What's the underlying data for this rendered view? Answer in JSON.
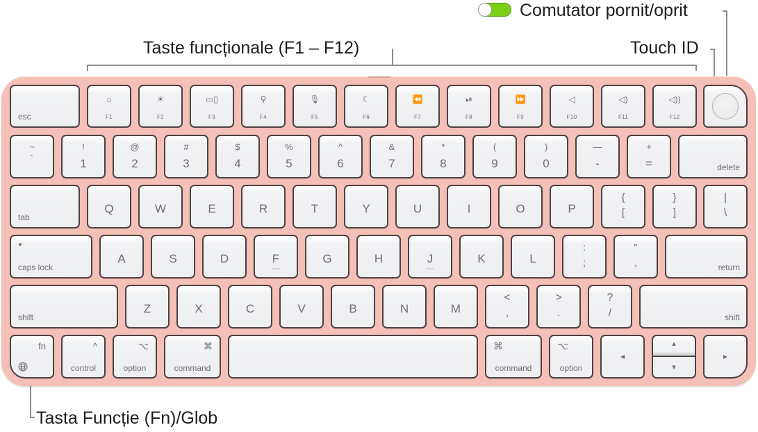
{
  "callouts": {
    "power_switch": "Comutator pornit/oprit",
    "function_keys": "Taste funcționale (F1 – F12)",
    "touch_id": "Touch ID",
    "fn_globe": "Tasta Funcție (Fn)/Glob"
  },
  "colors": {
    "keyboard_body": "#f4c0b8",
    "key_face": "#eeeff1",
    "key_outline": "#4d4142",
    "legend_text": "#6e6e73",
    "toggle_on": "#7ad014"
  },
  "toggle": {
    "state": "on"
  },
  "rows": {
    "function": {
      "esc": "esc",
      "fkeys": [
        {
          "label": "F1",
          "icon": "brightness-down-icon",
          "glyph": "☼"
        },
        {
          "label": "F2",
          "icon": "brightness-up-icon",
          "glyph": "☀"
        },
        {
          "label": "F3",
          "icon": "mission-control-icon",
          "glyph": "▭▯"
        },
        {
          "label": "F4",
          "icon": "search-icon",
          "glyph": "⚲"
        },
        {
          "label": "F5",
          "icon": "microphone-icon",
          "glyph": "🎙"
        },
        {
          "label": "F6",
          "icon": "moon-icon",
          "glyph": "☾"
        },
        {
          "label": "F7",
          "icon": "rewind-icon",
          "glyph": "⏪"
        },
        {
          "label": "F8",
          "icon": "play-pause-icon",
          "glyph": "⏯"
        },
        {
          "label": "F9",
          "icon": "fast-forward-icon",
          "glyph": "⏩"
        },
        {
          "label": "F10",
          "icon": "mute-icon",
          "glyph": "◁"
        },
        {
          "label": "F11",
          "icon": "volume-down-icon",
          "glyph": "◁)"
        },
        {
          "label": "F12",
          "icon": "volume-up-icon",
          "glyph": "◁))"
        }
      ]
    },
    "number": {
      "tilde": {
        "top": "~",
        "bot": "`"
      },
      "keys": [
        {
          "top": "!",
          "bot": "1"
        },
        {
          "top": "@",
          "bot": "2"
        },
        {
          "top": "#",
          "bot": "3"
        },
        {
          "top": "$",
          "bot": "4"
        },
        {
          "top": "%",
          "bot": "5"
        },
        {
          "top": "^",
          "bot": "6"
        },
        {
          "top": "&",
          "bot": "7"
        },
        {
          "top": "*",
          "bot": "8"
        },
        {
          "top": "(",
          "bot": "9"
        },
        {
          "top": ")",
          "bot": "0"
        },
        {
          "top": "—",
          "bot": "-"
        },
        {
          "top": "+",
          "bot": "="
        }
      ],
      "delete": "delete"
    },
    "qwerty": {
      "tab": "tab",
      "letters": [
        "Q",
        "W",
        "E",
        "R",
        "T",
        "Y",
        "U",
        "I",
        "O",
        "P"
      ],
      "brackets": [
        {
          "top": "{",
          "bot": "["
        },
        {
          "top": "}",
          "bot": "]"
        }
      ],
      "backslash": {
        "top": "|",
        "bot": "\\"
      }
    },
    "home": {
      "caps": "caps lock",
      "letters": [
        "A",
        "S",
        "D",
        "F",
        "G",
        "H",
        "J",
        "K",
        "L"
      ],
      "punct": [
        {
          "top": ":",
          "bot": ";"
        },
        {
          "top": "\"",
          "bot": ","
        }
      ],
      "return": "return"
    },
    "bottom_letters": {
      "shift_left": "shift",
      "letters": [
        "Z",
        "X",
        "C",
        "V",
        "B",
        "N",
        "M"
      ],
      "punct": [
        {
          "top": "<",
          "bot": ","
        },
        {
          "top": ">",
          "bot": "."
        },
        {
          "top": "?",
          "bot": "/"
        }
      ],
      "shift_right": "shift"
    },
    "modifiers": {
      "fn": "fn",
      "control": {
        "symbol": "^",
        "label": "control"
      },
      "option_left": {
        "symbol": "⌥",
        "label": "option"
      },
      "command_left": {
        "symbol": "⌘",
        "label": "command"
      },
      "command_right": {
        "symbol": "⌘",
        "label": "command"
      },
      "option_right": {
        "symbol": "⌥",
        "label": "option"
      },
      "arrow_left": "◂",
      "arrow_up": "▴",
      "arrow_down": "▾",
      "arrow_right": "▸"
    }
  }
}
